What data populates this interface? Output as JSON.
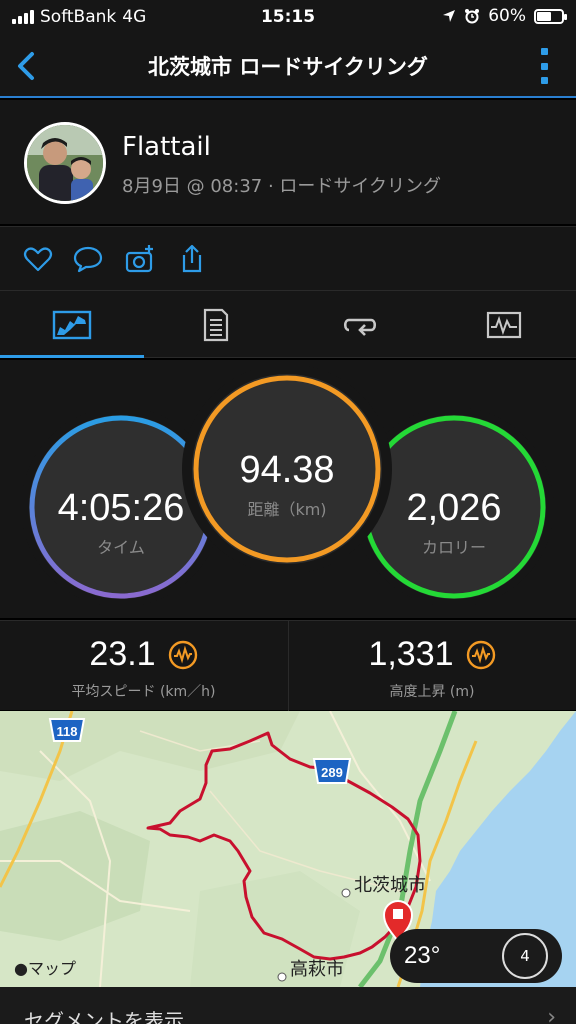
{
  "status_bar": {
    "carrier": "SoftBank",
    "network": "4G",
    "time": "15:15",
    "battery": "60%",
    "battery_level": 0.6
  },
  "nav": {
    "title": "北茨城市 ロードサイクリング"
  },
  "profile": {
    "name": "Flattail",
    "subtitle": "8月9日 @ 08:37 · ロードサイクリング"
  },
  "metrics": {
    "time": {
      "value": "4:05:26",
      "label": "タイム"
    },
    "distance": {
      "value": "94.38",
      "label": "距離（km)"
    },
    "calories": {
      "value": "2,026",
      "label": "カロリー"
    }
  },
  "stats": {
    "avg_speed": {
      "value": "23.1",
      "label": "平均スピード (km／h)"
    },
    "elevation": {
      "value": "1,331",
      "label": "高度上昇 (m)"
    }
  },
  "map": {
    "road_118": "118",
    "road_289": "289",
    "city_kitaibaraki": "北茨城市",
    "city_takahagi": "高萩市",
    "apple_maps": "マップ",
    "weather_temp": "23°",
    "wind_speed": "4"
  },
  "segment": {
    "label": "セグメントを表示"
  },
  "colors": {
    "accent": "#2e9ce8",
    "time_ring": "#5b7fd6",
    "distance_ring": "#f39a24",
    "calories_ring": "#24d936",
    "route": "#c8102e"
  }
}
